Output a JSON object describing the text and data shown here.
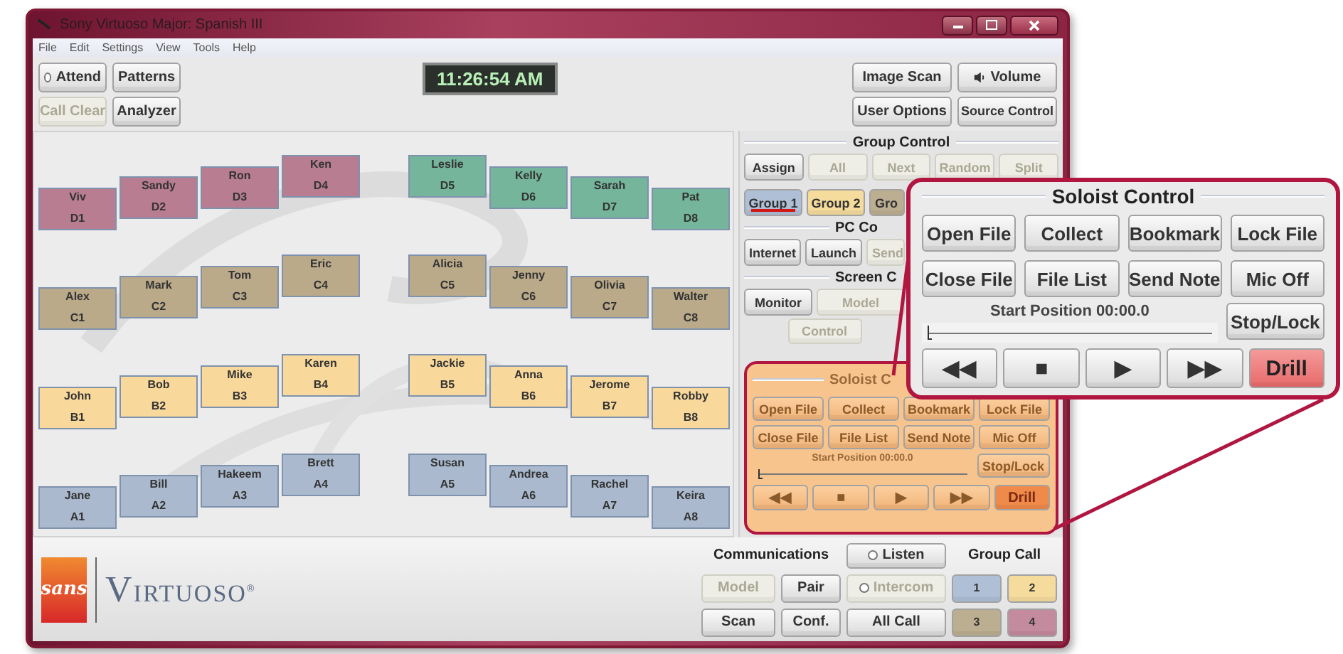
{
  "window": {
    "title": "Sony Virtuoso Major: Spanish III"
  },
  "menu": [
    "File",
    "Edit",
    "Settings",
    "View",
    "Tools",
    "Help"
  ],
  "toolbar_left": [
    {
      "label": "Attend",
      "kind": "radio",
      "checked": false,
      "disabled": false
    },
    {
      "label": "Patterns",
      "kind": "button",
      "disabled": false
    },
    {
      "label": "Call Clear",
      "kind": "button",
      "disabled": true
    },
    {
      "label": "Analyzer",
      "kind": "button",
      "disabled": false
    }
  ],
  "clock": "11:26:54 AM",
  "toolbar_right": [
    {
      "label": "Image Scan",
      "kind": "button"
    },
    {
      "label": "Volume",
      "kind": "speaker"
    },
    {
      "label": "User Options",
      "kind": "button"
    },
    {
      "label": "Source Control",
      "kind": "button"
    }
  ],
  "seat_rows": [
    {
      "seats": [
        {
          "name": "Viv",
          "seat": "D1",
          "color": "#b87d91"
        },
        {
          "name": "Sandy",
          "seat": "D2",
          "color": "#b87d91"
        },
        {
          "name": "Ron",
          "seat": "D3",
          "color": "#b87d91"
        },
        {
          "name": "Ken",
          "seat": "D4",
          "color": "#b87d91"
        },
        {
          "name": "Leslie",
          "seat": "D5",
          "color": "#74b59c"
        },
        {
          "name": "Kelly",
          "seat": "D6",
          "color": "#74b59c"
        },
        {
          "name": "Sarah",
          "seat": "D7",
          "color": "#74b59c"
        },
        {
          "name": "Pat",
          "seat": "D8",
          "color": "#74b59c"
        }
      ]
    },
    {
      "seats": [
        {
          "name": "Alex",
          "seat": "C1",
          "color": "#bbaa8a"
        },
        {
          "name": "Mark",
          "seat": "C2",
          "color": "#bbaa8a"
        },
        {
          "name": "Tom",
          "seat": "C3",
          "color": "#bbaa8a"
        },
        {
          "name": "Eric",
          "seat": "C4",
          "color": "#bbaa8a"
        },
        {
          "name": "Alicia",
          "seat": "C5",
          "color": "#bbaa8a"
        },
        {
          "name": "Jenny",
          "seat": "C6",
          "color": "#bbaa8a"
        },
        {
          "name": "Olivia",
          "seat": "C7",
          "color": "#bbaa8a"
        },
        {
          "name": "Walter",
          "seat": "C8",
          "color": "#bbaa8a"
        }
      ]
    },
    {
      "seats": [
        {
          "name": "John",
          "seat": "B1",
          "color": "#f9d99b"
        },
        {
          "name": "Bob",
          "seat": "B2",
          "color": "#f9d99b"
        },
        {
          "name": "Mike",
          "seat": "B3",
          "color": "#f9d99b"
        },
        {
          "name": "Karen",
          "seat": "B4",
          "color": "#f9d99b"
        },
        {
          "name": "Jackie",
          "seat": "B5",
          "color": "#f9d99b"
        },
        {
          "name": "Anna",
          "seat": "B6",
          "color": "#f9d99b"
        },
        {
          "name": "Jerome",
          "seat": "B7",
          "color": "#f9d99b"
        },
        {
          "name": "Robby",
          "seat": "B8",
          "color": "#f9d99b"
        }
      ]
    },
    {
      "seats": [
        {
          "name": "Jane",
          "seat": "A1",
          "color": "#aab9cd"
        },
        {
          "name": "Bill",
          "seat": "A2",
          "color": "#aab9cd"
        },
        {
          "name": "Hakeem",
          "seat": "A3",
          "color": "#aab9cd"
        },
        {
          "name": "Brett",
          "seat": "A4",
          "color": "#aab9cd"
        },
        {
          "name": "Susan",
          "seat": "A5",
          "color": "#aab9cd"
        },
        {
          "name": "Andrea",
          "seat": "A6",
          "color": "#aab9cd"
        },
        {
          "name": "Rachel",
          "seat": "A7",
          "color": "#aab9cd"
        },
        {
          "name": "Keira",
          "seat": "A8",
          "color": "#aab9cd"
        }
      ]
    }
  ],
  "group_control": {
    "title": "Group Control",
    "actions": [
      {
        "label": "Assign",
        "disabled": false
      },
      {
        "label": "All",
        "disabled": true
      },
      {
        "label": "Next",
        "disabled": true
      },
      {
        "label": "Random",
        "disabled": true
      },
      {
        "label": "Split",
        "disabled": true
      }
    ],
    "groups": [
      {
        "label": "Group 1",
        "color": "#aebfd6",
        "selected": true
      },
      {
        "label": "Group 2",
        "color": "#f6dc9c",
        "selected": false
      },
      {
        "label": "Gro",
        "color": "#bcae90",
        "selected": false
      }
    ]
  },
  "pc_control": {
    "title": "PC Co",
    "buttons": [
      {
        "label": "Internet",
        "disabled": false
      },
      {
        "label": "Launch",
        "disabled": false
      },
      {
        "label": "Send",
        "disabled": true
      }
    ]
  },
  "screen_control": {
    "title": "Screen C",
    "buttons": [
      {
        "label": "Monitor",
        "disabled": false
      },
      {
        "label": "Model",
        "disabled": true
      }
    ],
    "control": {
      "label": "Control",
      "disabled": true
    }
  },
  "soloist_panel": {
    "title": "Soloist C",
    "highlighted": true,
    "buttons": [
      {
        "label": "Open File"
      },
      {
        "label": "Collect"
      },
      {
        "label": "Bookmark"
      },
      {
        "label": "Lock File"
      },
      {
        "label": "Close File"
      },
      {
        "label": "File List"
      },
      {
        "label": "Send Note"
      },
      {
        "label": "Mic Off"
      }
    ],
    "position": "Start Position 00:00.0",
    "level": 0,
    "stop": "Stop/Lock",
    "transport": [
      {
        "label": "◀◀",
        "active": false
      },
      {
        "label": "■",
        "active": false
      },
      {
        "label": "▶",
        "active": false
      },
      {
        "label": "▶▶",
        "active": false
      },
      {
        "label": "Drill",
        "active": true
      }
    ]
  },
  "soloist_callout": {
    "title": "Soloist Control",
    "buttons": [
      {
        "label": "Open File"
      },
      {
        "label": "Collect"
      },
      {
        "label": "Bookmark"
      },
      {
        "label": "Lock File"
      },
      {
        "label": "Close File"
      },
      {
        "label": "File List"
      },
      {
        "label": "Send Note"
      },
      {
        "label": "Mic Off"
      }
    ],
    "position": "Start Position 00:00.0",
    "level": 0,
    "stop": "Stop/Lock",
    "transport": [
      {
        "label": "◀◀",
        "active": false
      },
      {
        "label": "■",
        "active": false
      },
      {
        "label": "▶",
        "active": false
      },
      {
        "label": "▶▶",
        "active": false
      },
      {
        "label": "Drill",
        "active": true
      }
    ]
  },
  "logo": {
    "mark": "sans",
    "name": "VIRTUOSO",
    "registered": "®"
  },
  "communications": {
    "title": "Communications",
    "listen": {
      "label": "Listen",
      "checked": false,
      "disabled": false
    },
    "intercom": {
      "label": "Intercom",
      "checked": false,
      "disabled": true
    },
    "model": {
      "label": "Model",
      "disabled": true
    },
    "pair": {
      "label": "Pair",
      "disabled": false
    },
    "scan": {
      "label": "Scan",
      "disabled": false
    },
    "conf": {
      "label": "Conf.",
      "disabled": false
    },
    "all_call": {
      "label": "All Call",
      "disabled": false
    }
  },
  "group_call": {
    "title": "Group Call",
    "groups": [
      {
        "label": "1",
        "color": "#aebfd6"
      },
      {
        "label": "2",
        "color": "#f6dc9c"
      },
      {
        "label": "3",
        "color": "#bcae90"
      },
      {
        "label": "4",
        "color": "#c48a9e"
      }
    ]
  }
}
